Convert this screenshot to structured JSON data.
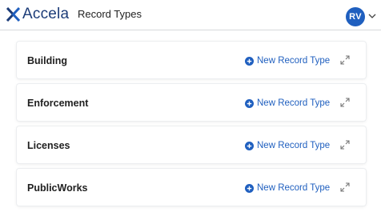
{
  "header": {
    "logo_text": "Accela",
    "title": "Record Types",
    "avatar_initials": "RV"
  },
  "colors": {
    "brand": "#1c3c78",
    "accent": "#1f5fbf"
  },
  "record_types": [
    {
      "label": "Building",
      "action_label": "New Record Type",
      "action_icon": "plus-circle-icon",
      "expand_icon": "expand-arrows-icon"
    },
    {
      "label": "Enforcement",
      "action_label": "New Record Type",
      "action_icon": "plus-circle-icon",
      "expand_icon": "expand-arrows-icon"
    },
    {
      "label": "Licenses",
      "action_label": "New Record Type",
      "action_icon": "plus-circle-icon",
      "expand_icon": "expand-arrows-icon"
    },
    {
      "label": "PublicWorks",
      "action_label": "New Record Type",
      "action_icon": "plus-circle-icon",
      "expand_icon": "expand-arrows-icon"
    }
  ]
}
